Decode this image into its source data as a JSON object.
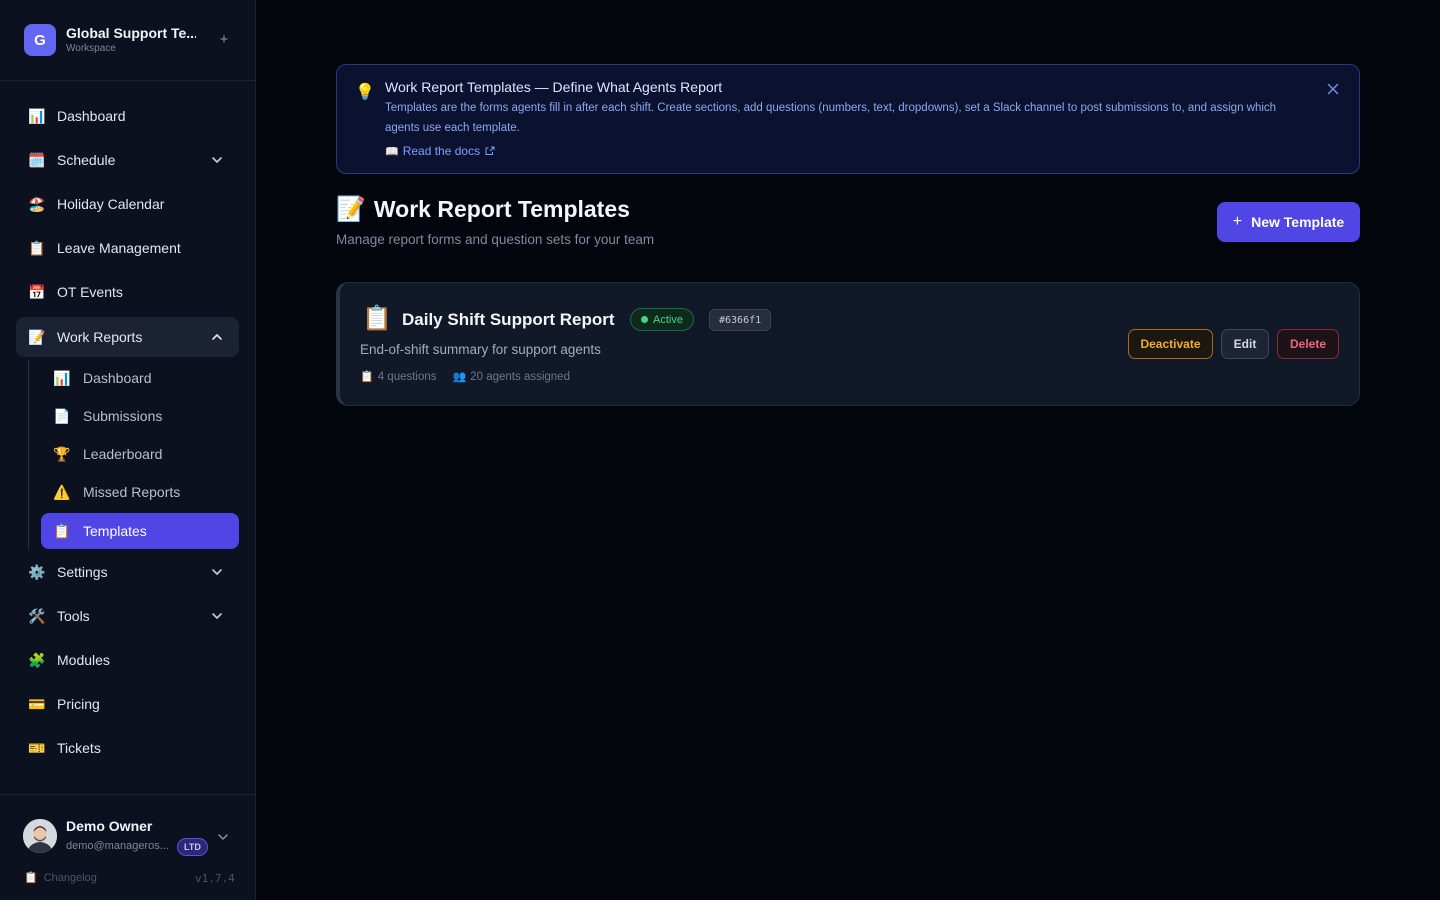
{
  "workspace": {
    "initial": "G",
    "name": "Global Support Te...",
    "subtitle": "Workspace",
    "add": "+"
  },
  "nav": {
    "dashboard": {
      "label": "Dashboard",
      "icon": "📊"
    },
    "schedule": {
      "label": "Schedule",
      "icon": "🗓️"
    },
    "holiday": {
      "label": "Holiday Calendar",
      "icon": "🏖️"
    },
    "leave": {
      "label": "Leave Management",
      "icon": "📋"
    },
    "ot": {
      "label": "OT Events",
      "icon": "📅"
    },
    "work_reports": {
      "label": "Work Reports",
      "icon": "📝"
    },
    "settings": {
      "label": "Settings",
      "icon": "⚙️"
    },
    "tools": {
      "label": "Tools",
      "icon": "🛠️"
    },
    "modules": {
      "label": "Modules",
      "icon": "🧩"
    },
    "pricing": {
      "label": "Pricing",
      "icon": "💳"
    },
    "tickets": {
      "label": "Tickets",
      "icon": "🎫"
    }
  },
  "work_reports_sub": {
    "dashboard": {
      "label": "Dashboard",
      "icon": "📊"
    },
    "submissions": {
      "label": "Submissions",
      "icon": "📄"
    },
    "leaderboard": {
      "label": "Leaderboard",
      "icon": "🏆"
    },
    "missed": {
      "label": "Missed Reports",
      "icon": "⚠️"
    },
    "templates": {
      "label": "Templates",
      "icon": "📋"
    }
  },
  "user": {
    "name": "Demo Owner",
    "email": "demo@manageros...",
    "badge": "LTD",
    "changelog": "Changelog",
    "changelog_icon": "📋",
    "version": "v1.7.4"
  },
  "banner": {
    "icon": "💡",
    "title": "Work Report Templates — Define What Agents Report",
    "text": "Templates are the forms agents fill in after each shift. Create sections, add questions (numbers, text, dropdowns), set a Slack channel to post submissions to, and assign which agents use each template.",
    "link_icon": "📖",
    "link": "Read the docs"
  },
  "page": {
    "title_icon": "📝",
    "title": "Work Report Templates",
    "subtitle": "Manage report forms and question sets for your team",
    "new_button": "New Template",
    "new_button_icon": "+"
  },
  "template": {
    "icon": "📋",
    "name": "Daily Shift Support Report",
    "status": "Active",
    "color": "#6366f1",
    "description": "End-of-shift summary for support agents",
    "questions_icon": "📋",
    "questions": "4 questions",
    "agents_icon": "👥",
    "agents": "20 agents assigned",
    "deactivate": "Deactivate",
    "edit": "Edit",
    "delete": "Delete"
  }
}
